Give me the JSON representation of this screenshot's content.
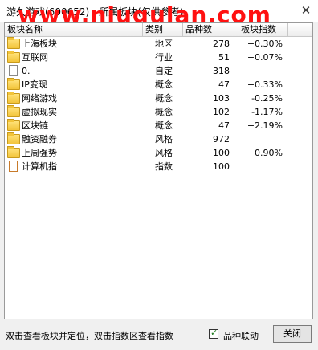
{
  "window": {
    "title": "游久游戏(600652) - 所属板块(仅供参考)",
    "close_glyph": "✕",
    "watermark": "www.niugulan.com"
  },
  "table": {
    "columns": [
      "板块名称",
      "类别",
      "品种数",
      "板块指数"
    ],
    "rows": [
      {
        "name": "上海板块",
        "icon": "folder-icon",
        "type": "地区",
        "count": "278",
        "index": "+0.30%"
      },
      {
        "name": "互联网",
        "icon": "folder-icon",
        "type": "行业",
        "count": "51",
        "index": "+0.07%"
      },
      {
        "name": "0.",
        "icon": "document-icon",
        "type": "自定",
        "count": "318",
        "index": ""
      },
      {
        "name": "IP变现",
        "icon": "folder-icon",
        "type": "概念",
        "count": "47",
        "index": "+0.33%"
      },
      {
        "name": "网络游戏",
        "icon": "folder-icon",
        "type": "概念",
        "count": "103",
        "index": "-0.25%"
      },
      {
        "name": "虚拟现实",
        "icon": "folder-icon",
        "type": "概念",
        "count": "102",
        "index": "-1.17%"
      },
      {
        "name": "区块链",
        "icon": "folder-icon",
        "type": "概念",
        "count": "47",
        "index": "+2.19%"
      },
      {
        "name": "融资融券",
        "icon": "folder-icon",
        "type": "风格",
        "count": "972",
        "index": ""
      },
      {
        "name": "上周强势",
        "icon": "folder-icon",
        "type": "风格",
        "count": "100",
        "index": "+0.90%"
      },
      {
        "name": "计算机指",
        "icon": "document-icon",
        "type": "指数",
        "count": "100",
        "index": ""
      }
    ]
  },
  "footer": {
    "hint": "双击查看板块并定位，双击指数区查看指数",
    "checkbox_label": "品种联动",
    "checkbox_checked": true,
    "close_label": "关闭"
  }
}
